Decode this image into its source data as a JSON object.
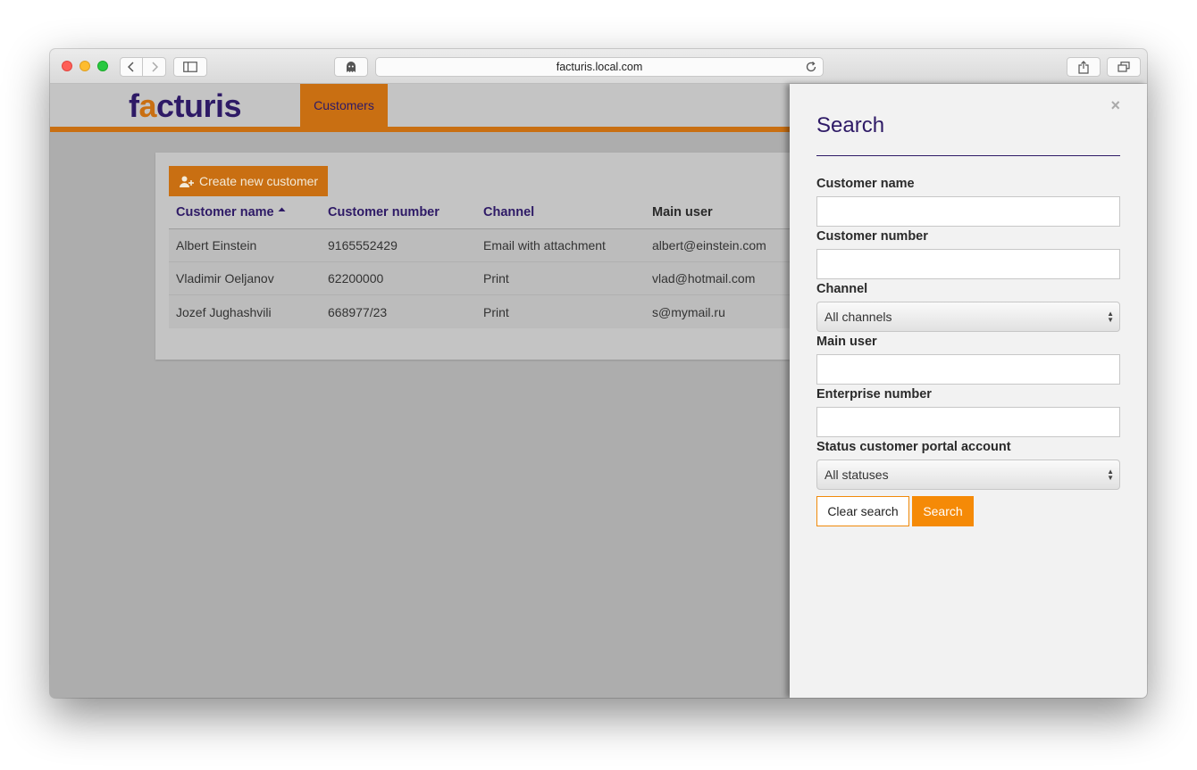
{
  "browser": {
    "url": "facturis.local.com"
  },
  "app": {
    "logo_prefix": "f",
    "logo_accent": "a",
    "logo_rest": "cturis",
    "nav_tab": "Customers",
    "brand_color": "#c96f12",
    "text_color": "#2e1a66"
  },
  "customers": {
    "create_label": "Create new customer",
    "columns": [
      "Customer name",
      "Customer number",
      "Channel",
      "Main user"
    ],
    "rows": [
      {
        "name": "Albert Einstein",
        "number": "9165552429",
        "channel": "Email with attachment",
        "user": "albert@einstein.com"
      },
      {
        "name": "Vladimir Oeljanov",
        "number": "62200000",
        "channel": "Print",
        "user": "vlad@hotmail.com"
      },
      {
        "name": "Jozef Jughashvili",
        "number": "668977/23",
        "channel": "Print",
        "user": "s@mymail.ru"
      }
    ]
  },
  "search_panel": {
    "title": "Search",
    "close": "×",
    "customer_name_label": "Customer name",
    "customer_number_label": "Customer number",
    "channel_label": "Channel",
    "channel_value": "All channels",
    "main_user_label": "Main user",
    "enterprise_number_label": "Enterprise number",
    "status_label": "Status customer portal account",
    "status_value": "All statuses",
    "clear_label": "Clear search",
    "search_label": "Search"
  }
}
